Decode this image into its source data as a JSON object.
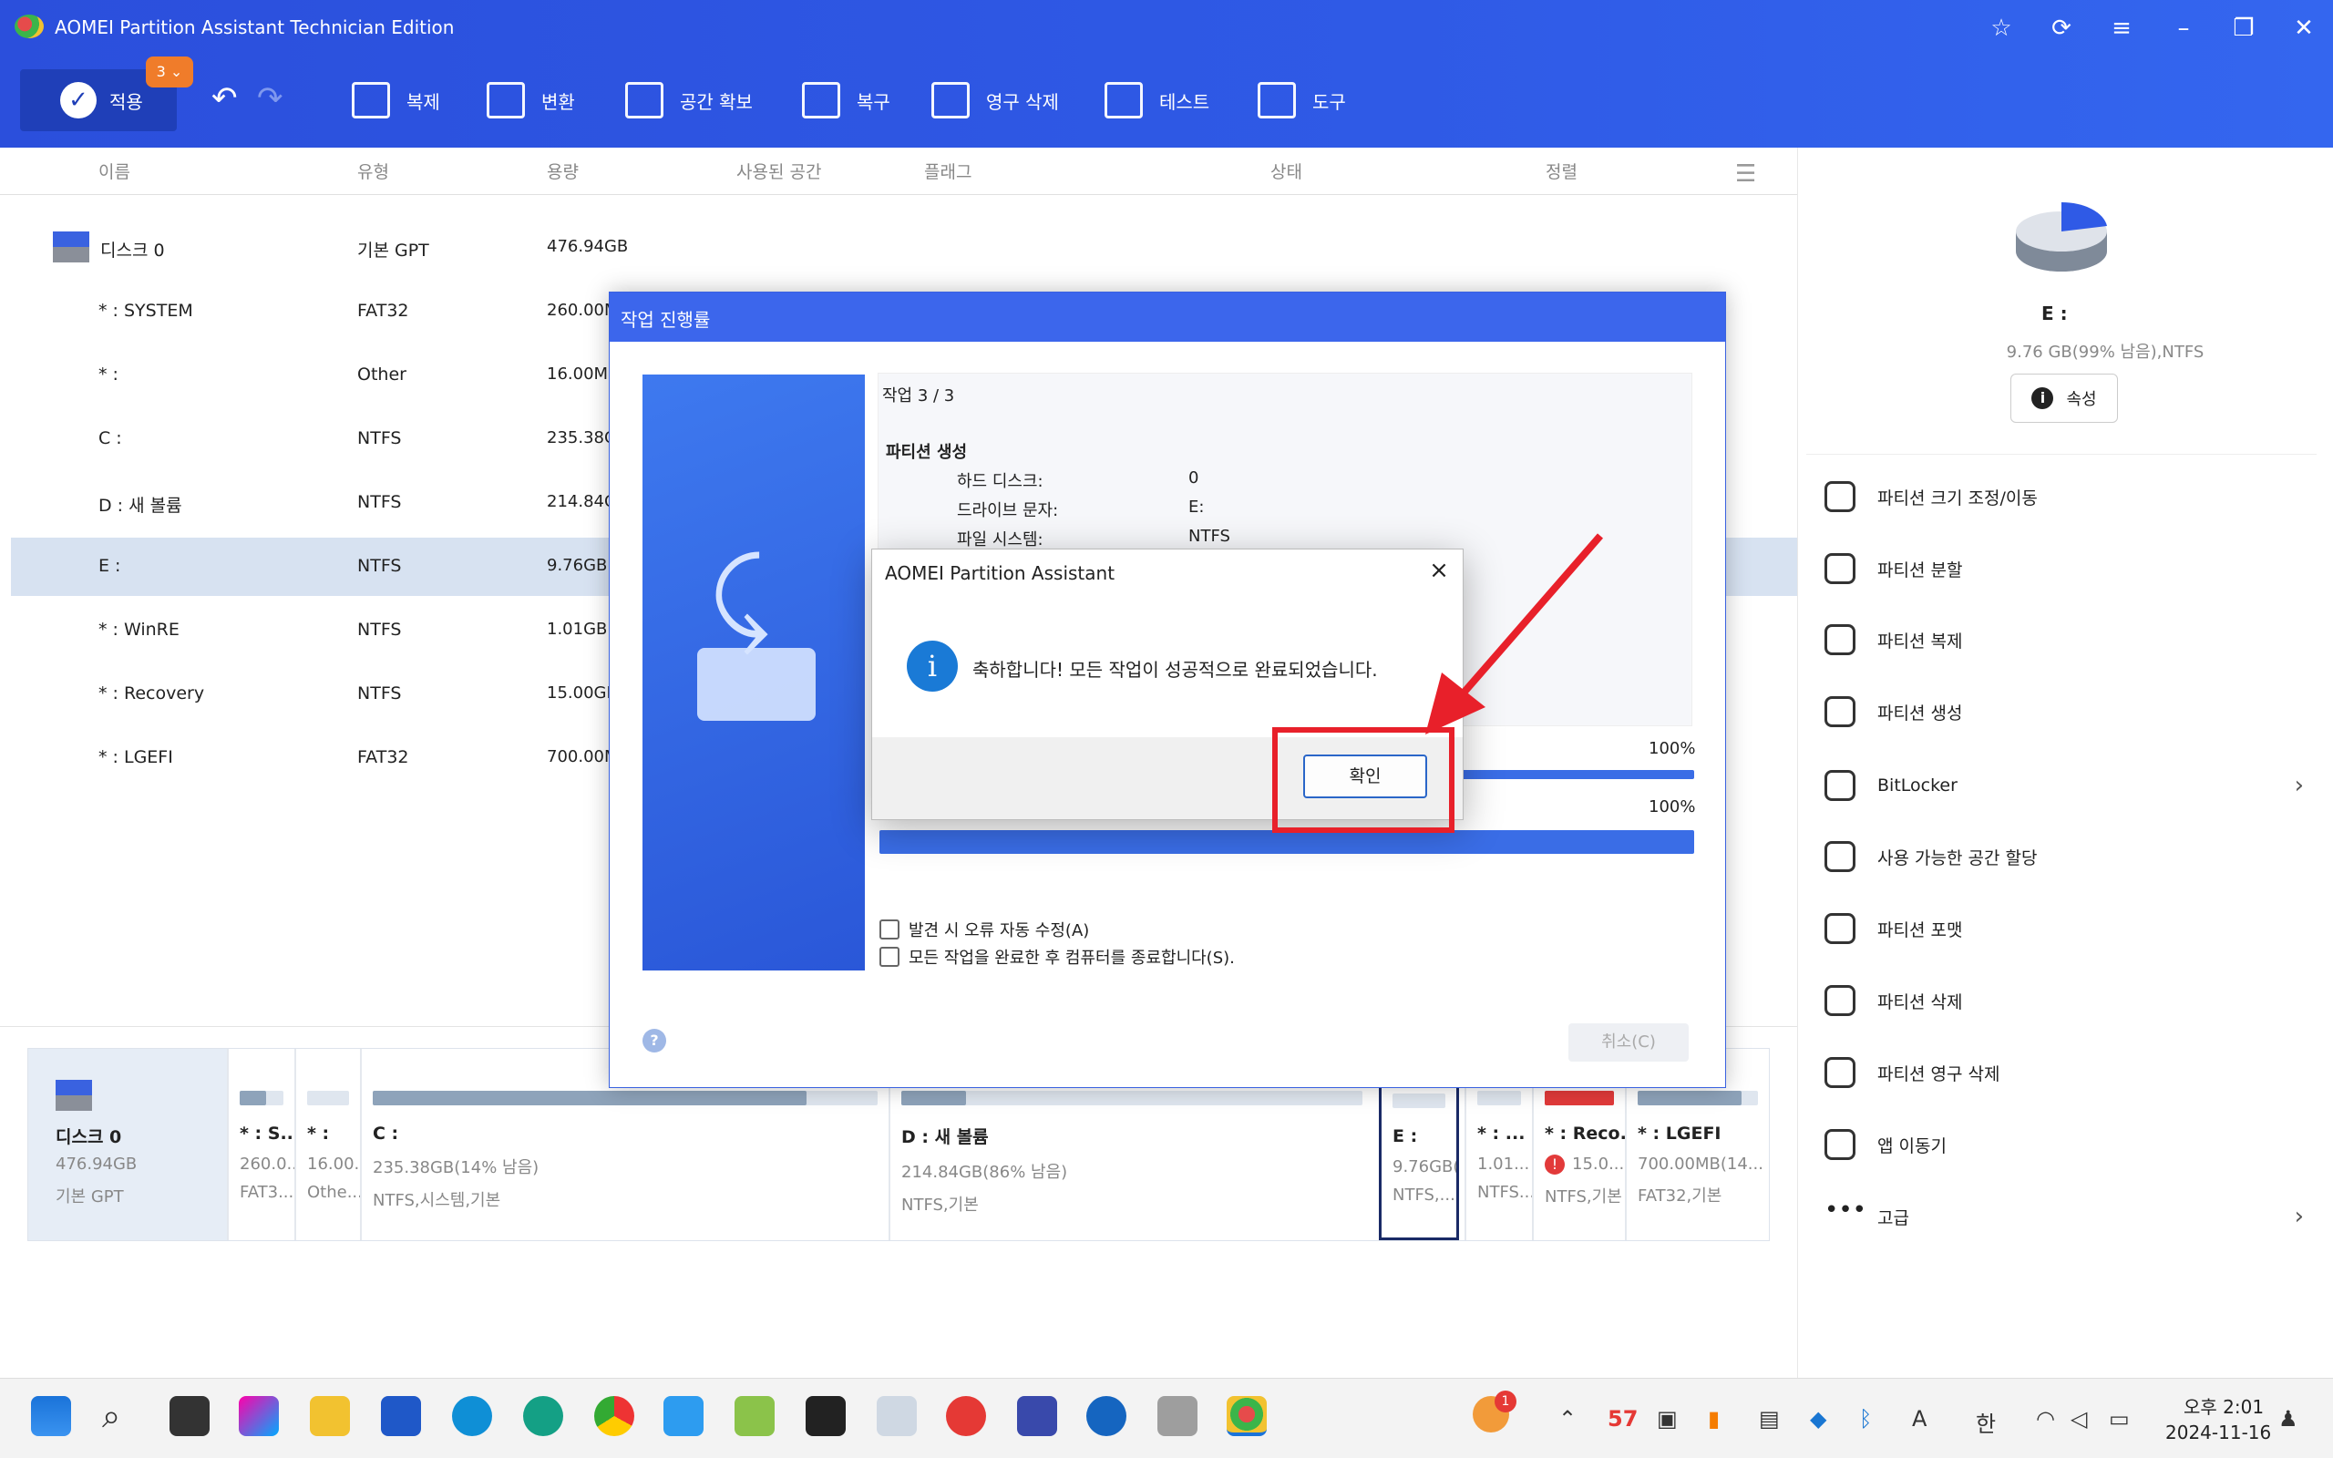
{
  "window": {
    "title": "AOMEI Partition Assistant Technician Edition"
  },
  "toolbar": {
    "apply": "적용",
    "pending": "3",
    "copy": "복제",
    "convert": "변환",
    "free_space": "공간 확보",
    "recover": "복구",
    "wipe": "영구 삭제",
    "test": "테스트",
    "tools": "도구"
  },
  "columns": {
    "name": "이름",
    "type": "유형",
    "capacity": "용량",
    "used": "사용된 공간",
    "flags": "플래그",
    "status": "상태",
    "align": "정렬"
  },
  "rows": [
    {
      "name": "디스크 0",
      "type": "기본 GPT",
      "cap": "476.94GB"
    },
    {
      "name": "* : SYSTEM",
      "type": "FAT32",
      "cap": "260.00M"
    },
    {
      "name": "* :",
      "type": "Other",
      "cap": "16.00MB"
    },
    {
      "name": "C :",
      "type": "NTFS",
      "cap": "235.38G"
    },
    {
      "name": "D : 새 볼륨",
      "type": "NTFS",
      "cap": "214.84G"
    },
    {
      "name": "E :",
      "type": "NTFS",
      "cap": "9.76GB"
    },
    {
      "name": "* : WinRE",
      "type": "NTFS",
      "cap": "1.01GB"
    },
    {
      "name": "* : Recovery",
      "type": "NTFS",
      "cap": "15.00GB"
    },
    {
      "name": "* : LGEFI",
      "type": "FAT32",
      "cap": "700.00M"
    }
  ],
  "right": {
    "sel_name": "E :",
    "sel_info": "9.76 GB(99% 남음),NTFS",
    "props": "속성",
    "ops": [
      "파티션 크기 조정/이동",
      "파티션 분할",
      "파티션 복제",
      "파티션 생성",
      "BitLocker",
      "사용 가능한 공간 할당",
      "파티션 포맷",
      "파티션 삭제",
      "파티션 영구 삭제",
      "앱 이동기",
      "고급"
    ]
  },
  "diskmap": {
    "disk": {
      "name": "디스크 0",
      "size": "476.94GB",
      "type": "기본 GPT"
    },
    "parts": [
      {
        "nm": "* : S...",
        "sz": "260.0...",
        "fs": "FAT3..."
      },
      {
        "nm": "* :",
        "sz": "16.00...",
        "fs": "Othe..."
      },
      {
        "nm": "C :",
        "sz": "235.38GB(14% 남음)",
        "fs": "NTFS,시스템,기본"
      },
      {
        "nm": "D : 새 볼륨",
        "sz": "214.84GB(86% 남음)",
        "fs": "NTFS,기본"
      },
      {
        "nm": "E :",
        "sz": "9.76GB(...",
        "fs": "NTFS,..."
      },
      {
        "nm": "* : ...",
        "sz": "1.01...",
        "fs": "NTFS..."
      },
      {
        "nm": "* : Reco...",
        "sz": "15.0...",
        "fs": "NTFS,기본"
      },
      {
        "nm": "* : LGEFI",
        "sz": "700.00MB(14...",
        "fs": "FAT32,기본"
      }
    ]
  },
  "progress": {
    "title": "작업 진행률",
    "step": "작업 3 / 3",
    "op": "파티션 생성",
    "k1": "하드 디스크:",
    "v1": "0",
    "k2": "드라이브 문자:",
    "v2": "E:",
    "k3": "파일 시스템:",
    "v3": "NTFS",
    "pct1": "100%",
    "pct2": "100%",
    "fix": "발견 시 오류 자동 수정(A)",
    "shutdown": "모든 작업을 완료한 후 컴퓨터를 종료합니다(S).",
    "cancel": "취소(C)"
  },
  "msgbox": {
    "title": "AOMEI Partition Assistant",
    "text": "축하합니다! 모든 작업이 성공적으로 완료되었습니다.",
    "ok": "확인"
  },
  "taskbar": {
    "notif": "1",
    "temp": "57",
    "time": "오후 2:01",
    "date": "2024-11-16",
    "ime": "한",
    "lang": "A"
  },
  "colors": {
    "accent": "#2f5ae6",
    "highlight": "#e8202a"
  }
}
